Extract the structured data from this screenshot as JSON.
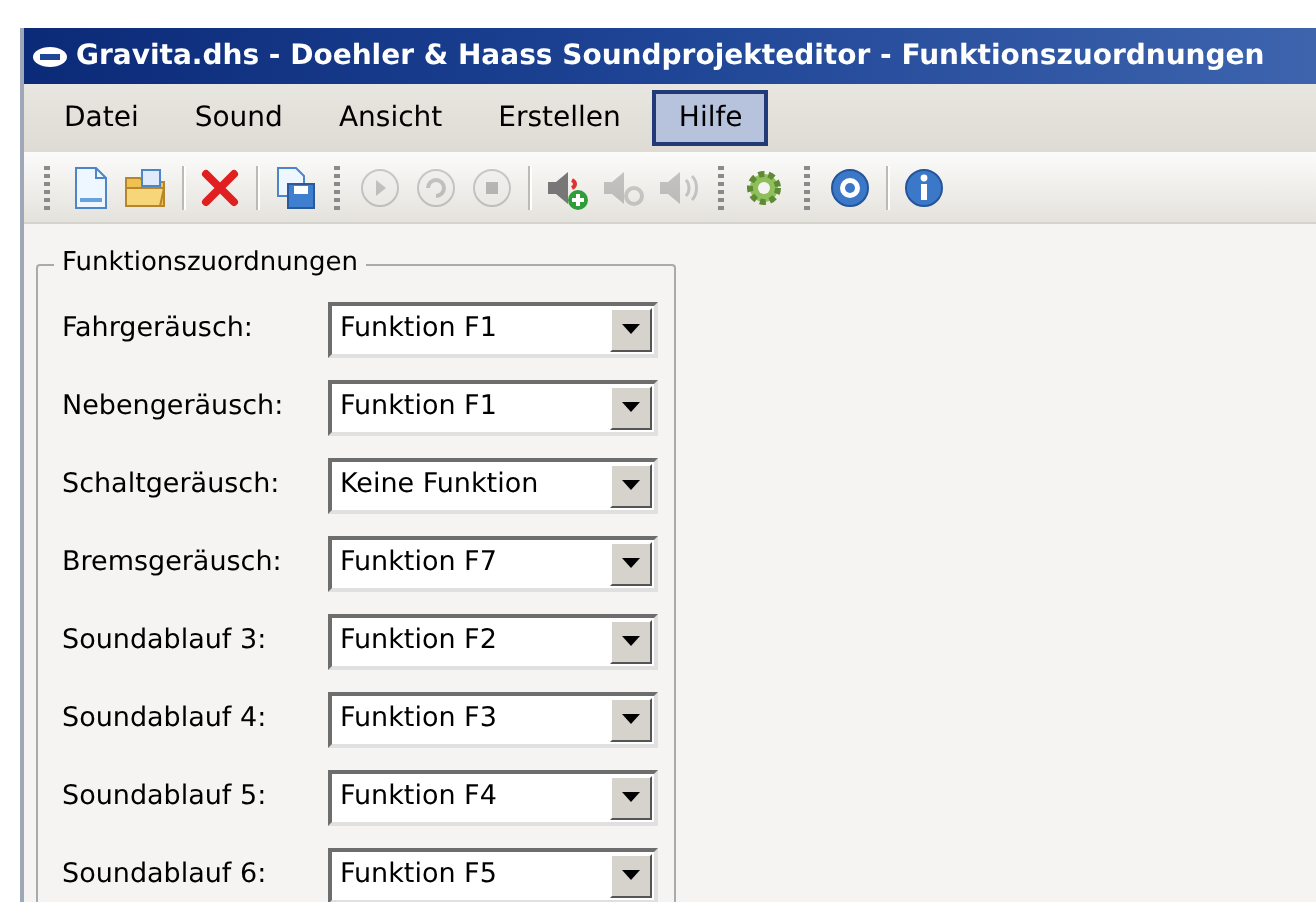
{
  "window": {
    "title": "Gravita.dhs - Doehler & Haass Soundprojekteditor - Funktionszuordnungen"
  },
  "menu": [
    {
      "label": "Datei",
      "selected": false
    },
    {
      "label": "Sound",
      "selected": false
    },
    {
      "label": "Ansicht",
      "selected": false
    },
    {
      "label": "Erstellen",
      "selected": false
    },
    {
      "label": "Hilfe",
      "selected": true
    }
  ],
  "toolbar": [
    {
      "kind": "new",
      "disabled": false
    },
    {
      "kind": "open",
      "disabled": false
    },
    {
      "kind": "sep"
    },
    {
      "kind": "delete",
      "disabled": false
    },
    {
      "kind": "sep"
    },
    {
      "kind": "saveas",
      "disabled": false
    },
    {
      "kind": "grip"
    },
    {
      "kind": "play",
      "disabled": true
    },
    {
      "kind": "repeat",
      "disabled": true
    },
    {
      "kind": "stop",
      "disabled": true
    },
    {
      "kind": "sep"
    },
    {
      "kind": "speaker-add",
      "disabled": false
    },
    {
      "kind": "speaker-gear",
      "disabled": true
    },
    {
      "kind": "speaker-sound",
      "disabled": true
    },
    {
      "kind": "grip"
    },
    {
      "kind": "gear",
      "disabled": false
    },
    {
      "kind": "grip"
    },
    {
      "kind": "help",
      "disabled": false
    },
    {
      "kind": "sep"
    },
    {
      "kind": "info",
      "disabled": false
    }
  ],
  "group": {
    "title": "Funktionszuordnungen",
    "rows": [
      {
        "label": "Fahrgeräusch:",
        "value": "Funktion F1"
      },
      {
        "label": "Nebengeräusch:",
        "value": "Funktion F1"
      },
      {
        "label": "Schaltgeräusch:",
        "value": "Keine Funktion"
      },
      {
        "label": "Bremsgeräusch:",
        "value": "Funktion F7"
      },
      {
        "label": "Soundablauf 3:",
        "value": "Funktion F2"
      },
      {
        "label": "Soundablauf 4:",
        "value": "Funktion F3"
      },
      {
        "label": "Soundablauf 5:",
        "value": "Funktion F4"
      },
      {
        "label": "Soundablauf 6:",
        "value": "Funktion F5"
      }
    ]
  }
}
